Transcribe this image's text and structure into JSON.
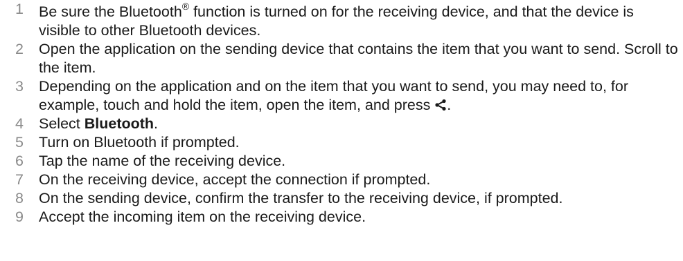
{
  "steps": [
    {
      "num": "1",
      "a": "Be sure the Bluetooth",
      "reg": "®",
      "b": " function is turned on for the receiving device, and that the device is visible to other Bluetooth devices."
    },
    {
      "num": "2",
      "text": "Open the application on the sending device that contains the item that you want to send. Scroll to the item."
    },
    {
      "num": "3",
      "a": "Depending on the application and on the item that you want to send, you may need to, for example, touch and hold the item, open the item, and press ",
      "b": ".",
      "icon": "share-icon"
    },
    {
      "num": "4",
      "a": "Select ",
      "bold": "Bluetooth",
      "b": "."
    },
    {
      "num": "5",
      "text": "Turn on Bluetooth if prompted."
    },
    {
      "num": "6",
      "text": "Tap the name of the receiving device."
    },
    {
      "num": "7",
      "text": "On the receiving device, accept the connection if prompted."
    },
    {
      "num": "8",
      "text": "On the sending device, confirm the transfer to the receiving device, if prompted."
    },
    {
      "num": "9",
      "text": "Accept the incoming item on the receiving device."
    }
  ]
}
